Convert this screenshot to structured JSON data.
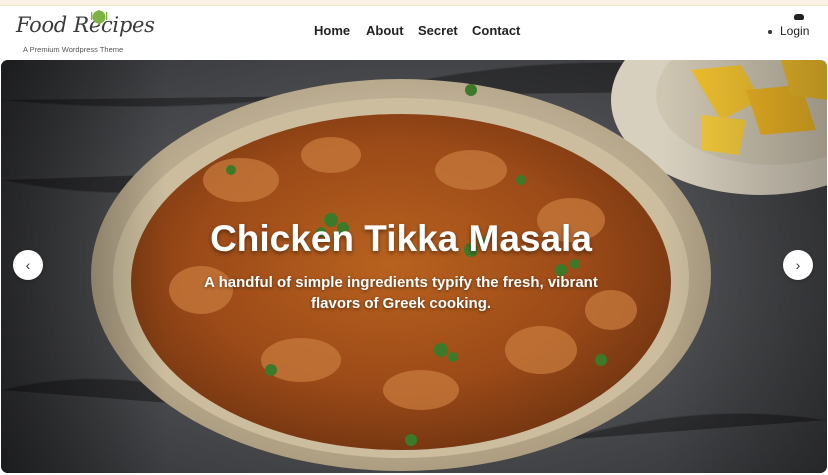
{
  "brand": {
    "name": "Food Recipes",
    "tagline": "A Premium Wordpress Theme",
    "accent": "#7cb342"
  },
  "nav": {
    "items": [
      "Home",
      "About",
      "Secret",
      "Contact"
    ],
    "login_label": "Login"
  },
  "hero": {
    "title": "Chicken Tikka Masala",
    "subtitle": "A handful of simple ingredients typify the fresh, vibrant flavors of Greek cooking.",
    "prev_icon": "‹",
    "next_icon": "›"
  },
  "icons": {
    "logo_mark": "fork-spoon-icon",
    "login": "user-icon",
    "prev": "chevron-left-icon",
    "next": "chevron-right-icon"
  },
  "colors": {
    "curry": "#a9521d",
    "bowl": "#d9cbb0",
    "cloth": "#4a4b4e",
    "mango": "#f4c430"
  }
}
